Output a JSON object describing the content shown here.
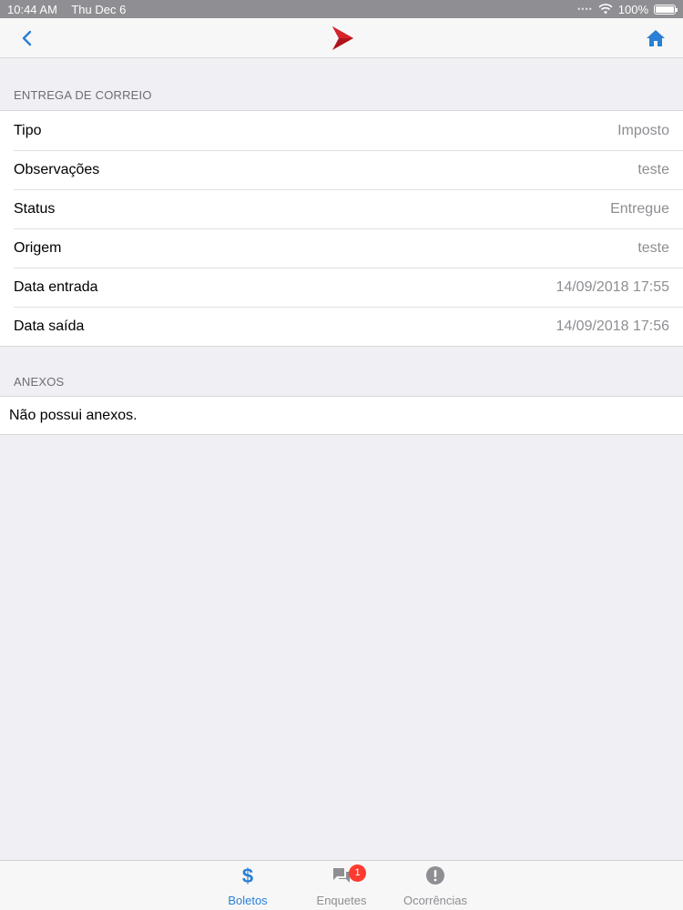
{
  "status_bar": {
    "time": "10:44 AM",
    "date": "Thu Dec 6",
    "battery": "100%",
    "battery_level": 1.0
  },
  "nav": {
    "back_icon": "chevron-left-icon",
    "logo_icon": "arrow-logo-icon",
    "home_icon": "home-icon",
    "accent_color": "#2a7fd6",
    "logo_color": "#b0141a"
  },
  "section_mail": {
    "title": "ENTREGA DE CORREIO",
    "rows": [
      {
        "label": "Tipo",
        "value": "Imposto"
      },
      {
        "label": "Observações",
        "value": "teste"
      },
      {
        "label": "Status",
        "value": "Entregue"
      },
      {
        "label": "Origem",
        "value": "teste"
      },
      {
        "label": "Data entrada",
        "value": "14/09/2018 17:55"
      },
      {
        "label": "Data saída",
        "value": "14/09/2018 17:56"
      }
    ]
  },
  "section_attachments": {
    "title": "ANEXOS",
    "empty_text": "Não possui anexos."
  },
  "tab_bar": {
    "tabs": [
      {
        "label": "Boletos",
        "icon": "dollar-icon",
        "active": true
      },
      {
        "label": "Enquetes",
        "icon": "chat-bubbles-icon",
        "active": false,
        "badge": "1"
      },
      {
        "label": "Ocorrências",
        "icon": "alert-circle-icon",
        "active": false
      }
    ]
  }
}
